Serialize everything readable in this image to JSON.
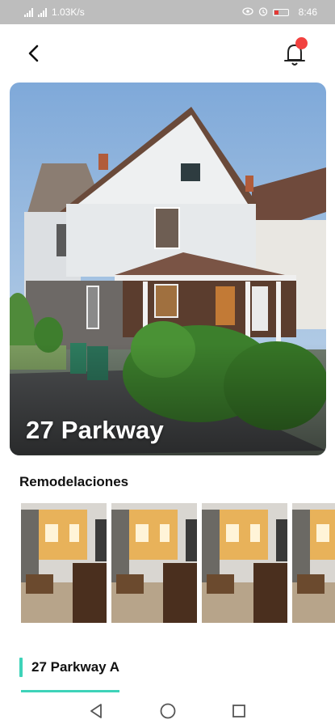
{
  "status_bar": {
    "network_speed": "1.03K/s",
    "time": "8:46",
    "battery_level": "15",
    "icons": [
      "signal-icon",
      "signal-icon",
      "wifi-icon",
      "eye-icon",
      "alarm-icon",
      "battery-icon"
    ]
  },
  "header": {
    "back_icon": "chevron-left-icon",
    "notification_icon": "bell-icon",
    "notification_dot_color": "#f2413f"
  },
  "property": {
    "title": "27 Parkway"
  },
  "remodel_section": {
    "title": "Remodelaciones",
    "photos": [
      {
        "name": "remodel-photo-1"
      },
      {
        "name": "remodel-photo-2"
      },
      {
        "name": "remodel-photo-3"
      },
      {
        "name": "remodel-photo-4"
      }
    ]
  },
  "units": {
    "active_label": "27 Parkway A",
    "accent_color": "#3ed3b9"
  },
  "nav_bar": {
    "icons": [
      "back-triangle-icon",
      "home-circle-icon",
      "recents-square-icon"
    ]
  }
}
